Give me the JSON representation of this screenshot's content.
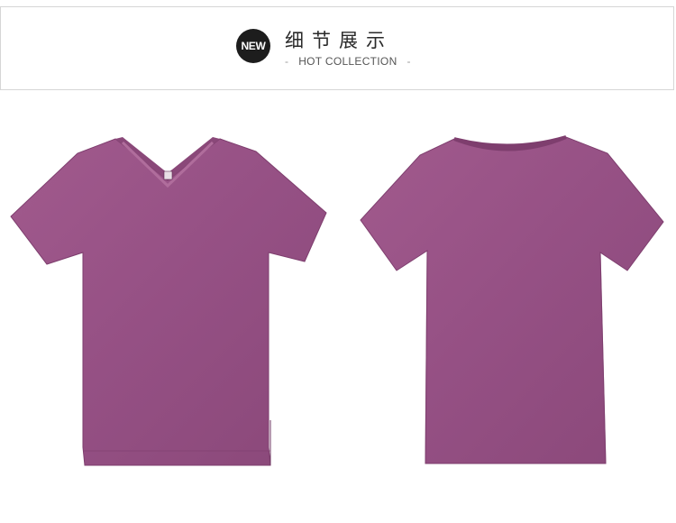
{
  "header": {
    "badge": "NEW",
    "title": "细节展示",
    "subtitle_dash_left": "-",
    "subtitle": "HOT COLLECTION",
    "subtitle_dash_right": "-"
  },
  "colors": {
    "shirt": "#9a5287",
    "shirt_dark": "#7e3e6e",
    "badge_bg": "#1d1d1d"
  },
  "images": {
    "front": "purple-v-neck-tshirt-front",
    "back": "purple-tshirt-back"
  }
}
